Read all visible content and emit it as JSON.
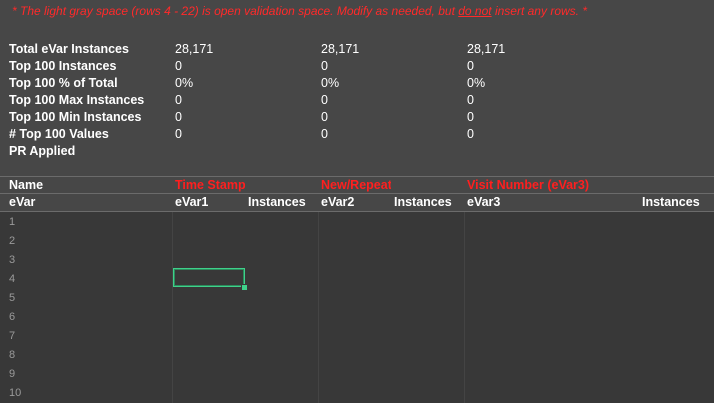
{
  "note": {
    "part1": "* The light gray space (rows 4 - 22) is open validation space. Modify as needed, but ",
    "underlined": "do not",
    "part2": " insert any rows. *"
  },
  "summary": [
    {
      "label": "Total eVar Instances",
      "v1": "28,171",
      "v2": "28,171",
      "v3": "28,171"
    },
    {
      "label": "Top 100 Instances",
      "v1": "0",
      "v2": "0",
      "v3": "0"
    },
    {
      "label": "Top 100  % of Total",
      "v1": "0%",
      "v2": "0%",
      "v3": "0%"
    },
    {
      "label": "Top 100 Max Instances",
      "v1": "0",
      "v2": "0",
      "v3": "0"
    },
    {
      "label": "Top 100 Min Instances",
      "v1": "0",
      "v2": "0",
      "v3": "0"
    },
    {
      "label": "# Top 100 Values",
      "v1": "0",
      "v2": "0",
      "v3": "0"
    },
    {
      "label": "PR Applied",
      "v1": "",
      "v2": "",
      "v3": ""
    }
  ],
  "header_name": {
    "name": "Name",
    "col1": "Time Stamp",
    "col2": "New/Repeat",
    "col3": "Visit Number (eVar3)"
  },
  "header_evar": {
    "evar": "eVar",
    "evar1": "eVar1",
    "inst1": "Instances",
    "evar2": "eVar2",
    "inst2": "Instances",
    "evar3": "eVar3",
    "inst3": "Instances"
  },
  "rows": [
    "1",
    "2",
    "3",
    "4",
    "5",
    "6",
    "7",
    "8",
    "9",
    "10"
  ],
  "colors": {
    "background": "#474747",
    "grid": "#383838",
    "red": "#ff1f1f",
    "selection": "#3fd18b"
  }
}
